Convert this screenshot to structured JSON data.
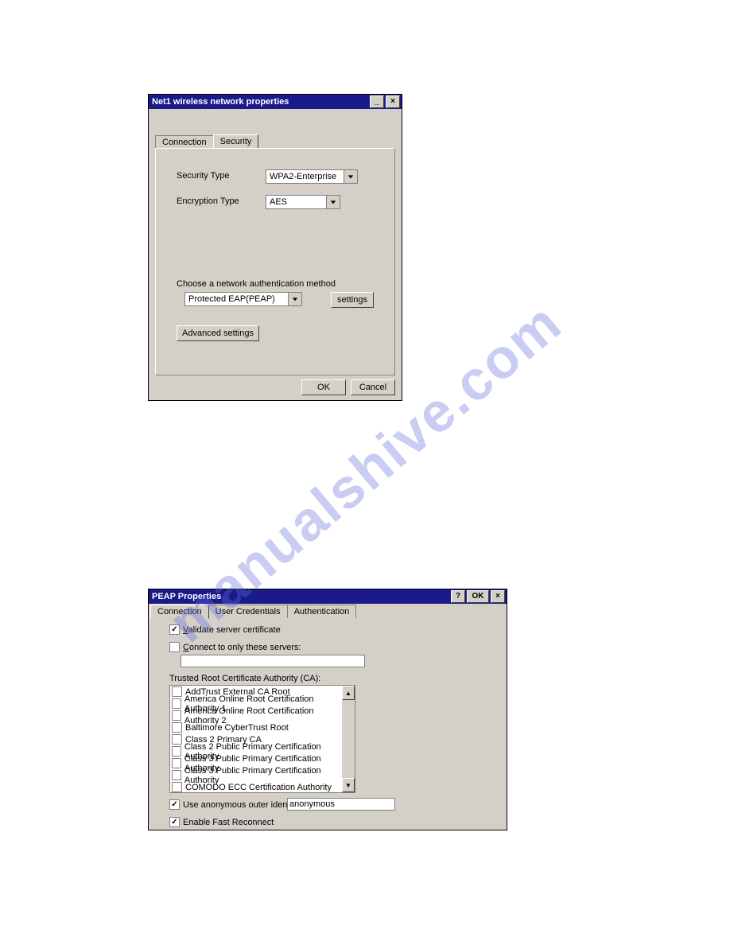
{
  "watermark": "manualshive.com",
  "window1": {
    "title": "Net1 wireless network properties",
    "tabs": {
      "connection": "Connection",
      "security": "Security"
    },
    "labels": {
      "security_type": "Security Type",
      "encryption_type": "Encryption Type",
      "auth_method": "Choose a network authentication method"
    },
    "selects": {
      "security_type": "WPA2-Enterprise",
      "encryption_type": "AES",
      "auth_method": "Protected EAP(PEAP)"
    },
    "buttons": {
      "settings": "settings",
      "advanced": "Advanced settings",
      "ok": "OK",
      "cancel": "Cancel"
    }
  },
  "window2": {
    "title": "PEAP Properties",
    "titlebar": {
      "help": "?",
      "ok": "OK",
      "close": "×"
    },
    "tabs": {
      "connection": "Connection",
      "user_credentials": "User Credentials",
      "authentication": "Authentication"
    },
    "checkboxes": {
      "validate": {
        "checked": true,
        "prefix": "V",
        "rest": "alidate server certificate"
      },
      "connect_only": {
        "checked": false,
        "prefix": "C",
        "rest": "onnect to only these servers:"
      },
      "anon": {
        "checked": true,
        "label": "Use anonymous outer identity"
      },
      "fast": {
        "checked": true,
        "label": "Enable Fast Reconnect"
      }
    },
    "servers_value": "",
    "ca_label": "Trusted Root Certificate Authority (CA):",
    "ca_items": [
      "AddTrust External CA Root",
      "America Online Root Certification Authority 1",
      "America Online Root Certification Authority 2",
      "Baltimore CyberTrust Root",
      "Class 2 Primary CA",
      "Class 2 Public Primary Certification Authority",
      "Class 3 Public Primary Certification Authority",
      "Class 3 Public Primary Certification Authority",
      "COMODO ECC Certification Authority"
    ],
    "anon_value": "anonymous"
  }
}
